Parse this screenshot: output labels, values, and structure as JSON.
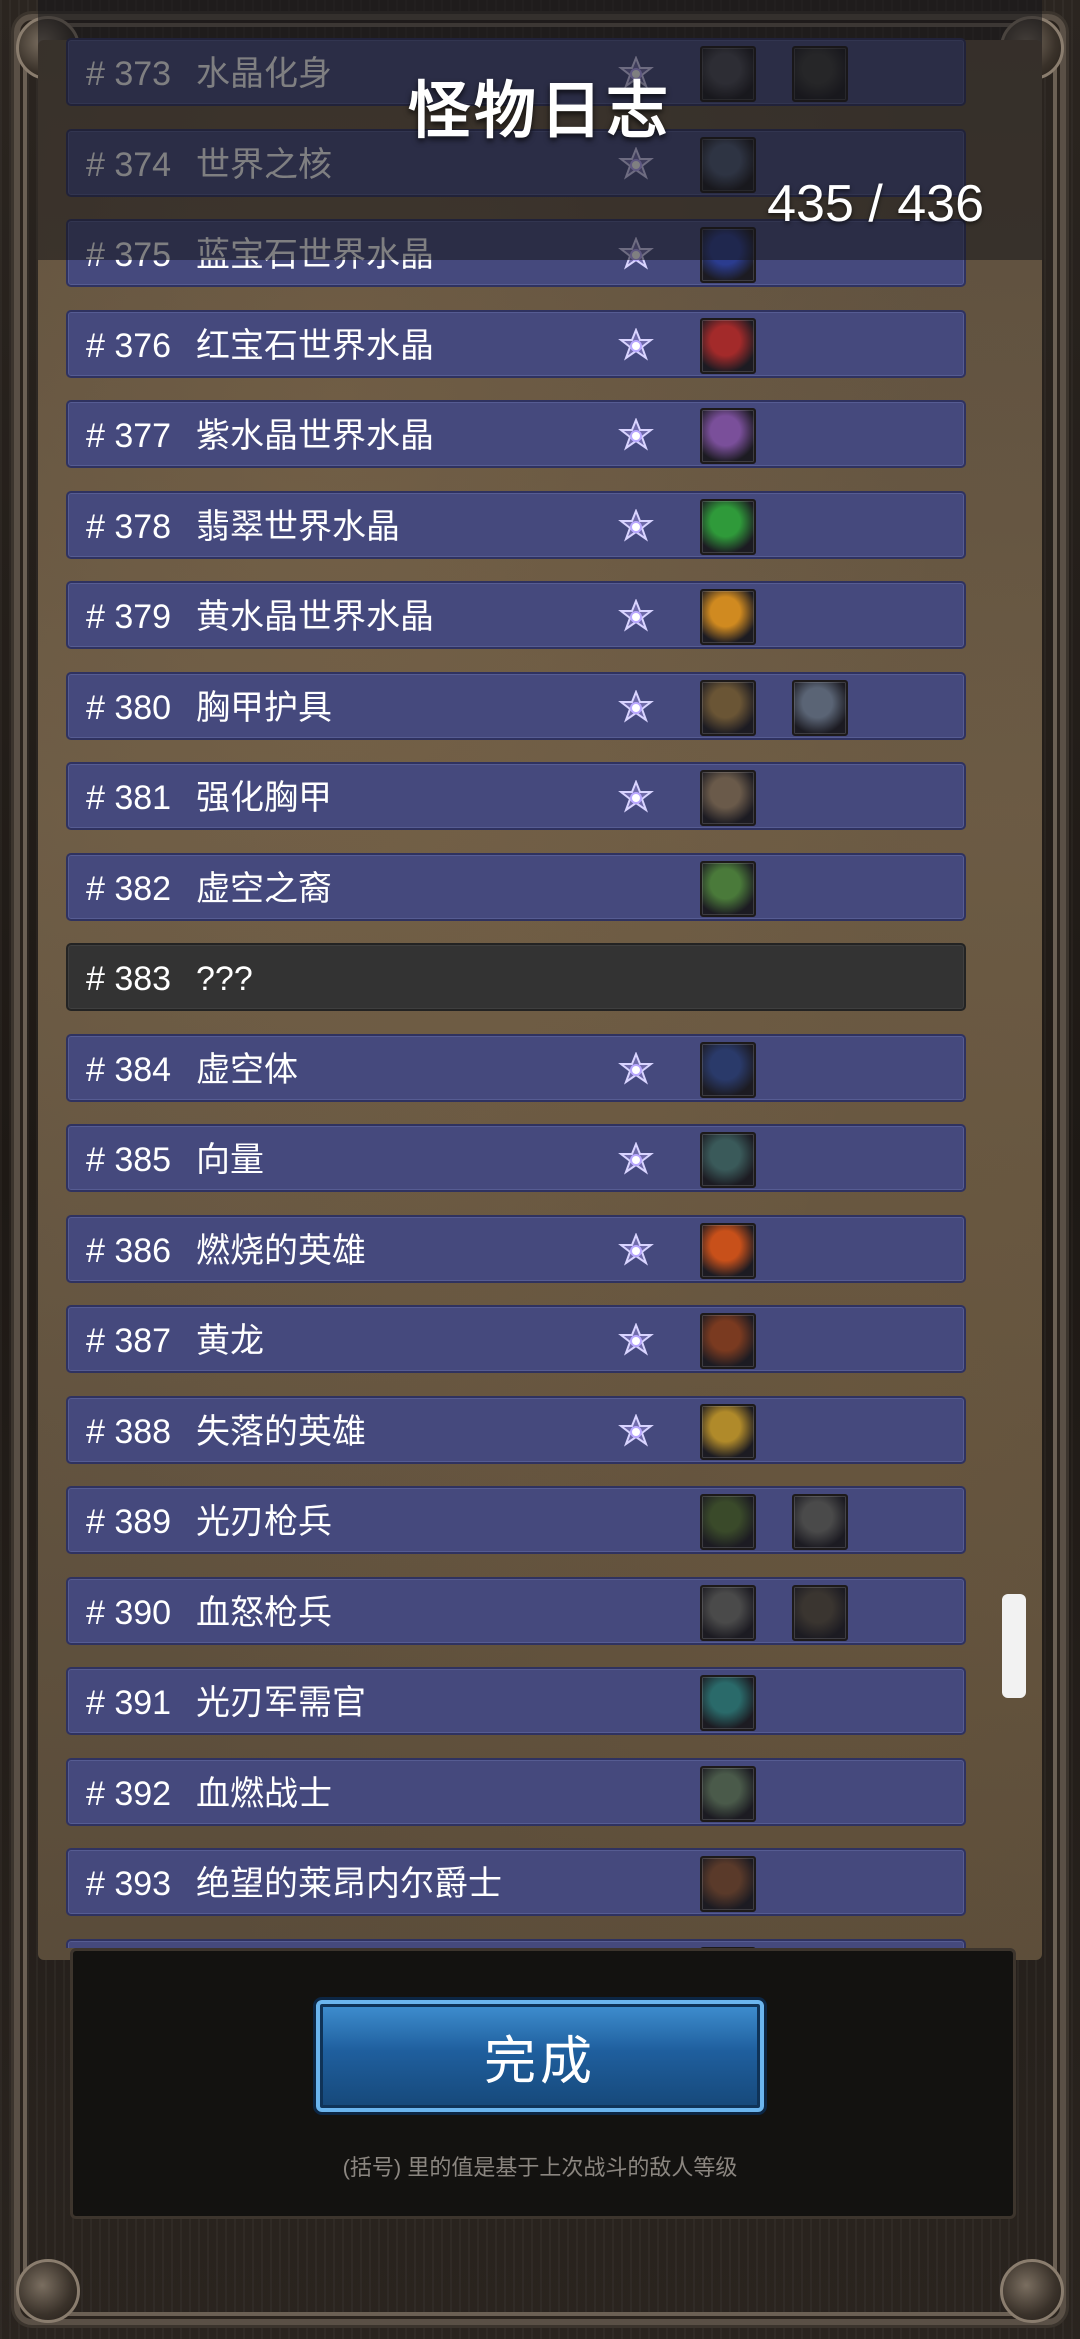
{
  "title": "怪物日志",
  "count": "435 / 436",
  "done_button": "完成",
  "footnote": "(括号) 里的值是基于上次战斗的敌人等级",
  "colors": {
    "row_bg": "#45497d",
    "unknown_row_bg": "#333333",
    "button_blue": "#1f5f9e"
  },
  "entries": [
    {
      "num": "# 373",
      "name": "水晶化身",
      "star": true,
      "items": [
        "#4a4a55",
        "#3a3a3a"
      ]
    },
    {
      "num": "# 374",
      "name": "世界之核",
      "star": true,
      "items": [
        "#4d5a77"
      ]
    },
    {
      "num": "# 375",
      "name": "蓝宝石世界水晶",
      "star": true,
      "items": [
        "#2b3c8f"
      ]
    },
    {
      "num": "# 376",
      "name": "红宝石世界水晶",
      "star": true,
      "items": [
        "#a32a2a"
      ]
    },
    {
      "num": "# 377",
      "name": "紫水晶世界水晶",
      "star": true,
      "items": [
        "#7a4f9a"
      ]
    },
    {
      "num": "# 378",
      "name": "翡翠世界水晶",
      "star": true,
      "items": [
        "#2f9a3a"
      ]
    },
    {
      "num": "# 379",
      "name": "黄水晶世界水晶",
      "star": true,
      "items": [
        "#d08a20"
      ]
    },
    {
      "num": "# 380",
      "name": "胸甲护具",
      "star": true,
      "items": [
        "#6a5535",
        "#5a6475"
      ]
    },
    {
      "num": "# 381",
      "name": "强化胸甲",
      "star": true,
      "items": [
        "#6a5a4a"
      ]
    },
    {
      "num": "# 382",
      "name": "虚空之裔",
      "star": false,
      "items": [
        "#4a7a3a"
      ]
    },
    {
      "num": "# 383",
      "name": "???",
      "star": false,
      "items": [],
      "unknown": true
    },
    {
      "num": "# 384",
      "name": "虚空体",
      "star": true,
      "items": [
        "#2a3a6a"
      ]
    },
    {
      "num": "# 385",
      "name": "向量",
      "star": true,
      "items": [
        "#3a5a5a"
      ]
    },
    {
      "num": "# 386",
      "name": "燃烧的英雄",
      "star": true,
      "items": [
        "#c8501a"
      ]
    },
    {
      "num": "# 387",
      "name": "黄龙",
      "star": true,
      "items": [
        "#7a3a20"
      ]
    },
    {
      "num": "# 388",
      "name": "失落的英雄",
      "star": true,
      "items": [
        "#b08a2a"
      ]
    },
    {
      "num": "# 389",
      "name": "光刃枪兵",
      "star": false,
      "items": [
        "#3a4a2a",
        "#4a4a4a"
      ]
    },
    {
      "num": "# 390",
      "name": "血怒枪兵",
      "star": false,
      "items": [
        "#4a4a4a",
        "#3a3530"
      ]
    },
    {
      "num": "# 391",
      "name": "光刃军需官",
      "star": false,
      "items": [
        "#2a6a6a"
      ]
    },
    {
      "num": "# 392",
      "name": "血燃战士",
      "star": false,
      "items": [
        "#4a5a4a"
      ]
    },
    {
      "num": "# 393",
      "name": "绝望的莱昂内尔爵士",
      "star": false,
      "items": [
        "#5a3a2a"
      ]
    },
    {
      "num": "",
      "name": "",
      "star": false,
      "items": [
        "#4a4a4a"
      ]
    }
  ]
}
